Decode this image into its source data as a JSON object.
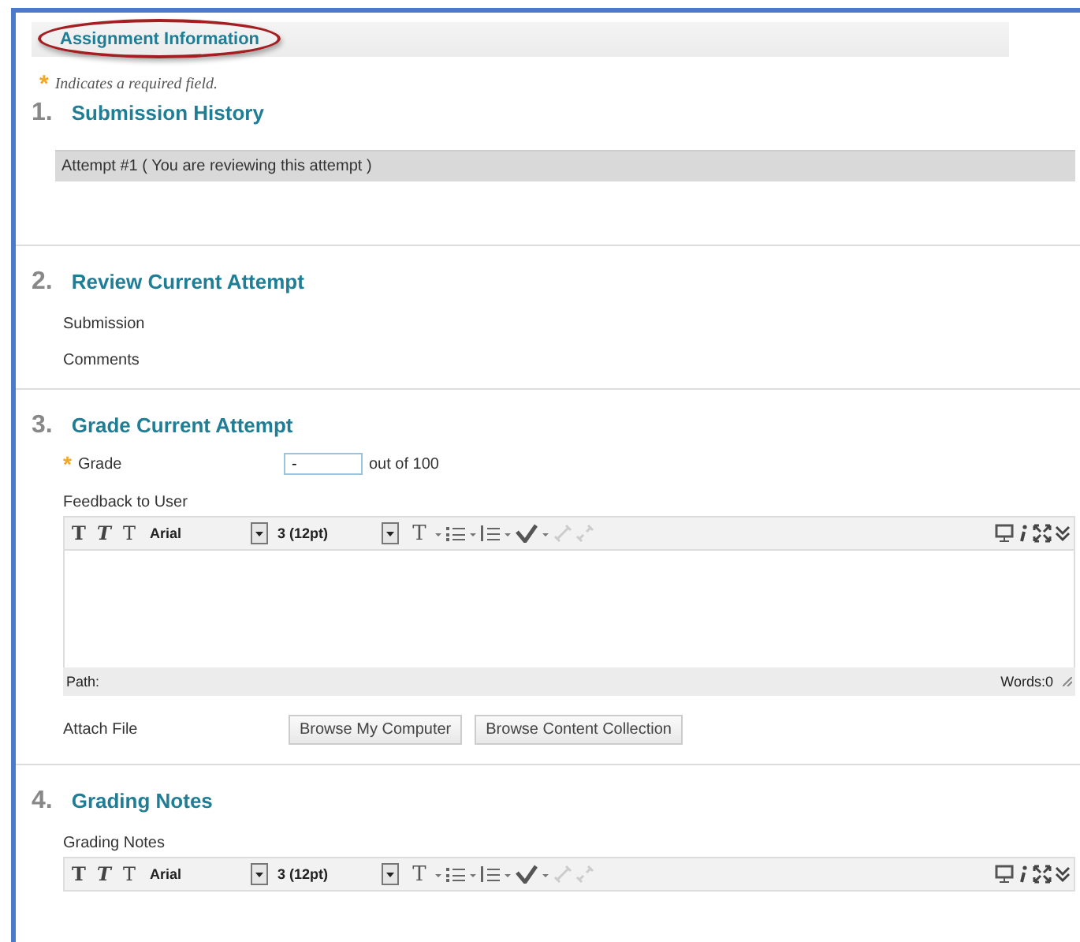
{
  "header": {
    "title": "Assignment Information",
    "circled": true
  },
  "required_note": {
    "mark": "*",
    "text": "Indicates a required field."
  },
  "sections": [
    {
      "number": "1.",
      "title": "Submission History",
      "items": [
        {
          "kind": "attempt",
          "text": "Attempt #1 ( You are reviewing this attempt )"
        }
      ]
    },
    {
      "number": "2.",
      "title": "Review Current Attempt",
      "items": [
        {
          "kind": "label",
          "text": "Submission"
        },
        {
          "kind": "label",
          "text": "Comments"
        }
      ]
    },
    {
      "number": "3.",
      "title": "Grade Current Attempt",
      "items": [
        {
          "kind": "grade",
          "mark": "*",
          "label": "Grade",
          "value": "-",
          "suffix": "out of 100"
        },
        {
          "kind": "label",
          "text": "Feedback to User"
        },
        {
          "kind": "editor",
          "format_buttons": [
            "T",
            "T",
            "T"
          ],
          "font": "Arial",
          "size": "3 (12pt)",
          "text_color": "T",
          "path": "Path:",
          "words": "Words:0"
        },
        {
          "kind": "attach",
          "label": "Attach File",
          "buttons": [
            "Browse My Computer",
            "Browse Content Collection"
          ]
        }
      ]
    },
    {
      "number": "4.",
      "title": "Grading Notes",
      "items": [
        {
          "kind": "label",
          "text": "Grading Notes"
        },
        {
          "kind": "editor",
          "format_buttons": [
            "T",
            "T",
            "T"
          ],
          "font": "Arial",
          "size": "3 (12pt)",
          "text_color": "T"
        }
      ]
    }
  ]
}
